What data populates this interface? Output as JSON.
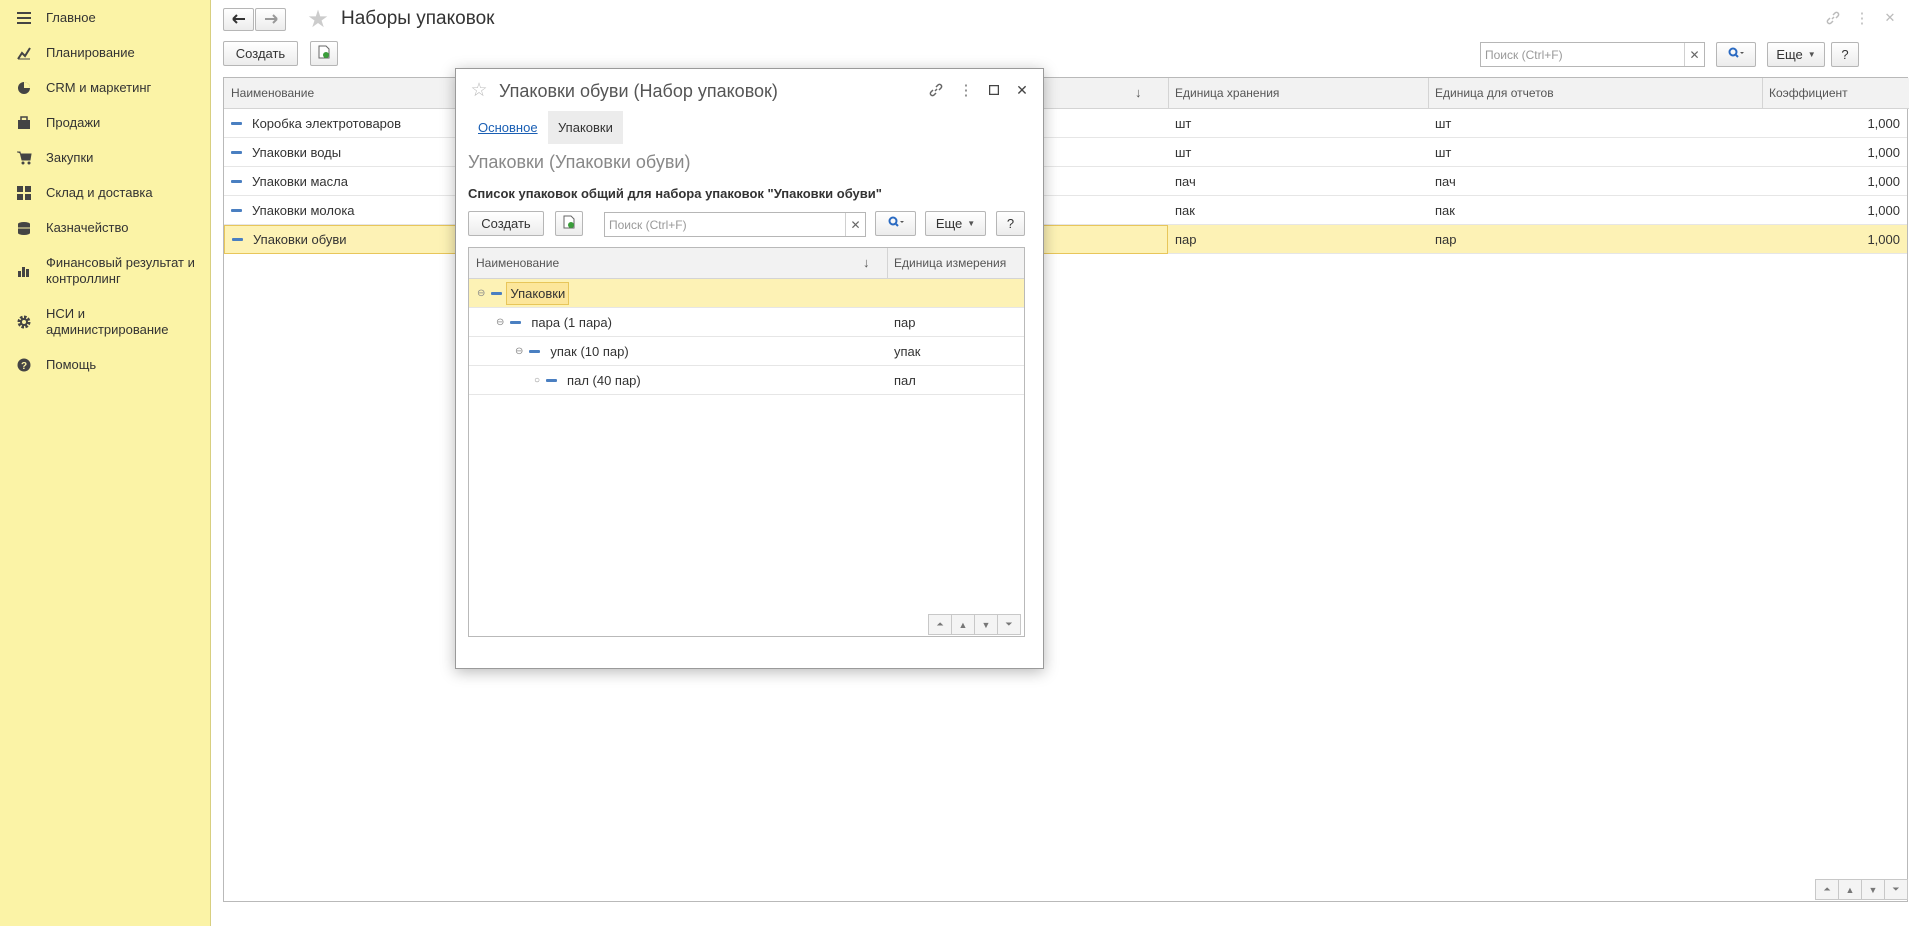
{
  "sidebar": {
    "items": [
      {
        "label": "Главное",
        "icon": "menu-icon"
      },
      {
        "label": "Планирование",
        "icon": "planning-icon"
      },
      {
        "label": "CRM и маркетинг",
        "icon": "pie-chart-icon"
      },
      {
        "label": "Продажи",
        "icon": "briefcase-icon"
      },
      {
        "label": "Закупки",
        "icon": "cart-icon"
      },
      {
        "label": "Склад и доставка",
        "icon": "warehouse-icon"
      },
      {
        "label": "Казначейство",
        "icon": "coins-icon"
      },
      {
        "label": "Финансовый результат и контроллинг",
        "icon": "bar-chart-icon"
      },
      {
        "label": "НСИ и администрирование",
        "icon": "gear-icon"
      },
      {
        "label": "Помощь",
        "icon": "help-icon"
      }
    ]
  },
  "page": {
    "title": "Наборы упаковок"
  },
  "toolbar": {
    "create_label": "Создать",
    "search_placeholder": "Поиск (Ctrl+F)",
    "more_label": "Еще",
    "help_label": "?"
  },
  "table": {
    "columns": [
      "Наименование",
      "Единица хранения",
      "Единица для отчетов",
      "Коэффициент"
    ],
    "rows": [
      {
        "name": "Коробка электротоваров",
        "storage": "шт",
        "report": "шт",
        "coef": "1,000"
      },
      {
        "name": "Упаковки воды",
        "storage": "шт",
        "report": "шт",
        "coef": "1,000"
      },
      {
        "name": "Упаковки масла",
        "storage": "пач",
        "report": "пач",
        "coef": "1,000"
      },
      {
        "name": "Упаковки молока",
        "storage": "пак",
        "report": "пак",
        "coef": "1,000"
      },
      {
        "name": "Упаковки обуви",
        "storage": "пар",
        "report": "пар",
        "coef": "1,000"
      }
    ]
  },
  "modal": {
    "title": "Упаковки обуви (Набор упаковок)",
    "tabs": [
      "Основное",
      "Упаковки"
    ],
    "subtitle": "Упаковки (Упаковки обуви)",
    "heading": "Список упаковок общий для набора упаковок \"Упаковки обуви\"",
    "create_label": "Создать",
    "search_placeholder": "Поиск (Ctrl+F)",
    "more_label": "Еще",
    "help_label": "?",
    "columns": [
      "Наименование",
      "Единица измерения"
    ],
    "rows": [
      {
        "name": "Упаковки",
        "unit": ""
      },
      {
        "name": "пара (1 пара)",
        "unit": "пар"
      },
      {
        "name": "упак (10 пар)",
        "unit": "упак"
      },
      {
        "name": "пал (40 пар)",
        "unit": "пал"
      }
    ]
  },
  "colors": {
    "sidebar_bg": "#fbf3a6",
    "selection": "#fdf2b5",
    "link": "#1a5fb4"
  }
}
